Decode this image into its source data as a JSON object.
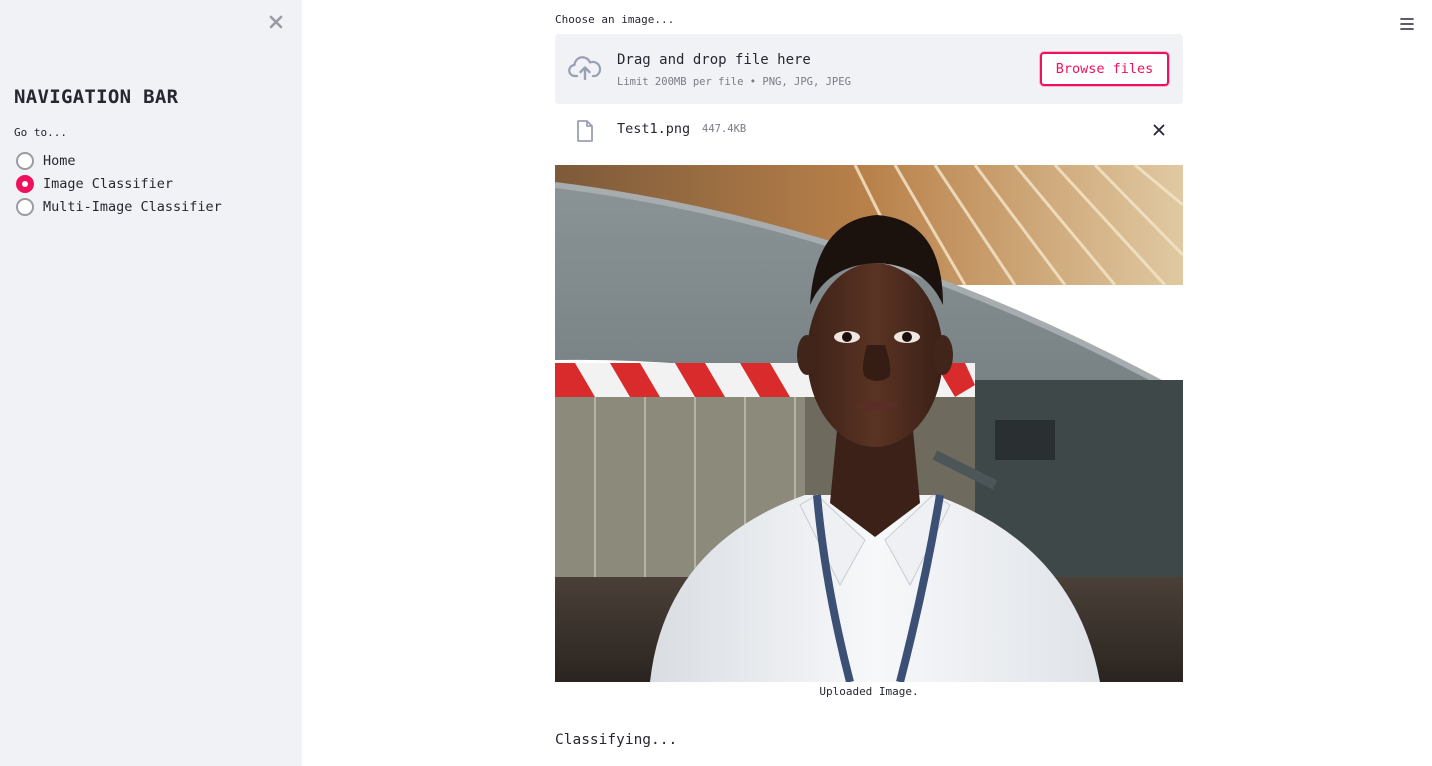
{
  "sidebar": {
    "title": "NAVIGATION BAR",
    "radio_label": "Go to...",
    "options": [
      {
        "label": "Home",
        "selected": false
      },
      {
        "label": "Image Classifier",
        "selected": true
      },
      {
        "label": "Multi-Image Classifier",
        "selected": false
      }
    ]
  },
  "uploader": {
    "label": "Choose an image...",
    "drop_title": "Drag and drop file here",
    "drop_subtitle": "Limit 200MB per file • PNG, JPG, JPEG",
    "browse_label": "Browse files",
    "file": {
      "name": "Test1.png",
      "size": "447.4KB"
    }
  },
  "image": {
    "caption": "Uploaded Image."
  },
  "status_text": "Classifying...",
  "colors": {
    "accent": "#f0115e",
    "sidebar_bg": "#f0f2f6",
    "text": "#262730",
    "muted": "#7a7b85"
  },
  "icons": [
    "close-icon",
    "menu-icon",
    "cloud-upload-icon",
    "file-icon",
    "remove-file-icon"
  ]
}
